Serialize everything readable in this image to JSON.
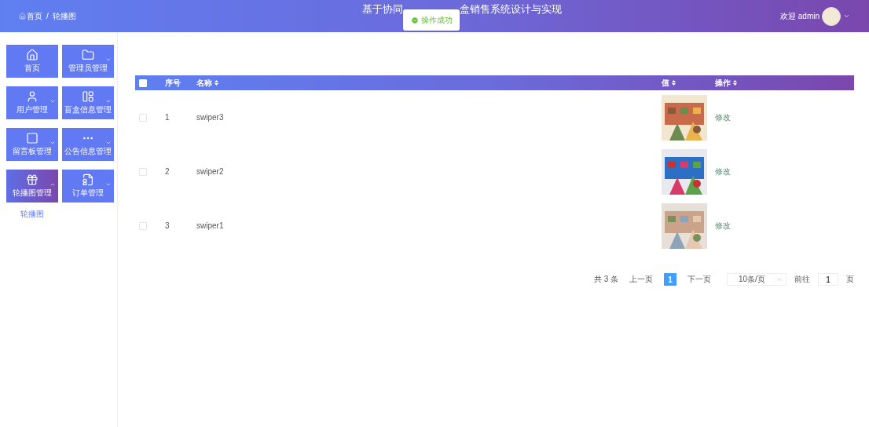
{
  "header": {
    "breadcrumb": [
      {
        "label": "首页",
        "kind": "home"
      },
      {
        "label": "/",
        "kind": "separator"
      },
      {
        "label": "轮播图",
        "kind": "page"
      }
    ],
    "title_parts": [
      "基于协同",
      "盒销售系统设计与实现"
    ],
    "toast": "操作成功",
    "welcome": "欢迎 admin"
  },
  "sidebar": {
    "items": [
      {
        "label": "首页",
        "kind": "link",
        "selected": false
      },
      {
        "label": "管理员管理",
        "kind": "group",
        "selected": false,
        "expanded": false
      },
      {
        "label": "用户管理",
        "kind": "group",
        "selected": false,
        "expanded": false
      },
      {
        "label": "盲盒信息管理",
        "kind": "group",
        "selected": false,
        "expanded": false
      },
      {
        "label": "留言板管理",
        "kind": "group",
        "selected": false,
        "expanded": false
      },
      {
        "label": "公告信息管理",
        "kind": "group",
        "selected": false,
        "expanded": false
      },
      {
        "label": "轮播图管理",
        "kind": "group",
        "selected": true,
        "expanded": true,
        "children": [
          {
            "label": "轮播图"
          }
        ]
      },
      {
        "label": "订单管理",
        "kind": "group",
        "selected": false,
        "expanded": false
      }
    ]
  },
  "table": {
    "all_checked": false,
    "columns": [
      {
        "label": "序号",
        "sortable": false
      },
      {
        "label": "名称",
        "sortable": true
      },
      {
        "label": "值",
        "sortable": true
      },
      {
        "label": "操作",
        "sortable": true
      }
    ],
    "rows": [
      {
        "checked": false,
        "index": "1",
        "name": "swiper3",
        "action": "修改"
      },
      {
        "checked": false,
        "index": "2",
        "name": "swiper2",
        "action": "修改"
      },
      {
        "checked": false,
        "index": "3",
        "name": "swiper1",
        "action": "修改"
      }
    ]
  },
  "pagination": {
    "total": "共 3 条",
    "prev": "上一页",
    "pages": [
      {
        "label": "1",
        "selected": true
      }
    ],
    "next": "下一页",
    "page_size": "10条/页",
    "goto_label": "前往",
    "goto_value": "1",
    "goto_suffix": "页"
  }
}
